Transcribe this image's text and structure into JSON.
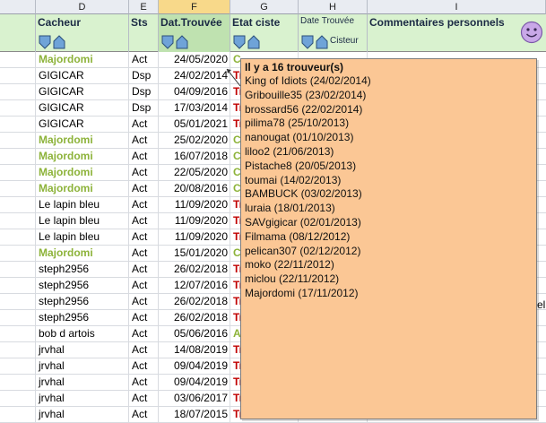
{
  "columns": [
    "D",
    "E",
    "F",
    "G",
    "H",
    "I"
  ],
  "headers": {
    "cacheur": "Cacheur",
    "sts": "Sts",
    "dat_trouvee": "Dat.Trouvée",
    "etat_ciste": "Etat ciste",
    "date_trouvee_label": "Date Trouvée",
    "cisteur": "Cisteur",
    "commentaires": "Commentaires personnels"
  },
  "rows": [
    {
      "cacheur": "Majordomi",
      "green": true,
      "sts": "Act",
      "date": "24/05/2020",
      "g": "C"
    },
    {
      "cacheur": "GIGICAR",
      "green": false,
      "sts": "Dsp",
      "date": "24/02/2014",
      "g": "Tr"
    },
    {
      "cacheur": "GIGICAR",
      "green": false,
      "sts": "Dsp",
      "date": "04/09/2016",
      "g": "Tr"
    },
    {
      "cacheur": "GIGICAR",
      "green": false,
      "sts": "Dsp",
      "date": "17/03/2014",
      "g": "Tr"
    },
    {
      "cacheur": "GIGICAR",
      "green": false,
      "sts": "Act",
      "date": "05/01/2021",
      "g": "Tr"
    },
    {
      "cacheur": "Majordomi",
      "green": true,
      "sts": "Act",
      "date": "25/02/2020",
      "g": "C"
    },
    {
      "cacheur": "Majordomi",
      "green": true,
      "sts": "Act",
      "date": "16/07/2018",
      "g": "C"
    },
    {
      "cacheur": "Majordomi",
      "green": true,
      "sts": "Act",
      "date": "22/05/2020",
      "g": "C"
    },
    {
      "cacheur": "Majordomi",
      "green": true,
      "sts": "Act",
      "date": "20/08/2016",
      "g": "C"
    },
    {
      "cacheur": "Le lapin bleu",
      "green": false,
      "sts": "Act",
      "date": "11/09/2020",
      "g": "Tr"
    },
    {
      "cacheur": "Le lapin bleu",
      "green": false,
      "sts": "Act",
      "date": "11/09/2020",
      "g": "Tr"
    },
    {
      "cacheur": "Le lapin bleu",
      "green": false,
      "sts": "Act",
      "date": "11/09/2020",
      "g": "Tr"
    },
    {
      "cacheur": "Majordomi",
      "green": true,
      "sts": "Act",
      "date": "15/01/2020",
      "g": "C"
    },
    {
      "cacheur": "steph2956",
      "green": false,
      "sts": "Act",
      "date": "26/02/2018",
      "g": "Tr"
    },
    {
      "cacheur": "steph2956",
      "green": false,
      "sts": "Act",
      "date": "12/07/2016",
      "g": "Tr"
    },
    {
      "cacheur": "steph2956",
      "green": false,
      "sts": "Act",
      "date": "26/02/2018",
      "g": "Tr"
    },
    {
      "cacheur": "steph2956",
      "green": false,
      "sts": "Act",
      "date": "26/02/2018",
      "g": "Tr"
    },
    {
      "cacheur": "bob d artois",
      "green": false,
      "sts": "Act",
      "date": "05/06/2016",
      "g": "A"
    },
    {
      "cacheur": "jrvhal",
      "green": false,
      "sts": "Act",
      "date": "14/08/2019",
      "g": "Tr"
    },
    {
      "cacheur": "jrvhal",
      "green": false,
      "sts": "Act",
      "date": "09/04/2019",
      "g": "Tr"
    },
    {
      "cacheur": "jrvhal",
      "green": false,
      "sts": "Act",
      "date": "09/04/2019",
      "g": "Tr"
    },
    {
      "cacheur": "jrvhal",
      "green": false,
      "sts": "Act",
      "date": "03/06/2017",
      "g": "Tr"
    },
    {
      "cacheur": "jrvhal",
      "green": false,
      "sts": "Act",
      "date": "18/07/2015",
      "g": "Tr"
    }
  ],
  "tooltip": {
    "title": "Il y a 16 trouveur(s)",
    "items": [
      "King of Idiots (24/02/2014)",
      "Gribouille35 (23/02/2014)",
      "brossard56 (22/02/2014)",
      "pilima78 (25/10/2013)",
      "nanougat (01/10/2013)",
      "liloo2 (21/06/2013)",
      "Pistache8 (20/05/2013)",
      "toumai (14/02/2013)",
      "BAMBUCK (03/02/2013)",
      "luraia (18/01/2013)",
      "SAVgigicar (02/01/2013)",
      "Filmama (08/12/2012)",
      "pelican307 (02/12/2012)",
      "moko (22/11/2012)",
      "miclou (22/11/2012)",
      "Majordomi (17/11/2012)"
    ]
  },
  "partial_text": "ell",
  "colors": {
    "green": "#8db33a",
    "red": "#c00000",
    "tooltip_bg": "#fbc795",
    "header_bg": "#d9f2cf",
    "selected_col": "#f8d98a"
  }
}
